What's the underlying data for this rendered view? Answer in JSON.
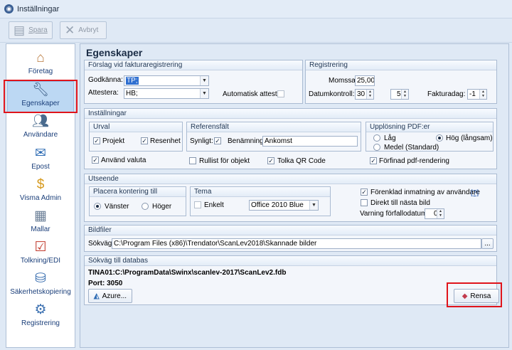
{
  "window": {
    "title": "Inställningar"
  },
  "toolbar": {
    "save_label": "Spara",
    "cancel_label": "Avbryt"
  },
  "sidebar": {
    "items": [
      {
        "label": "Företag",
        "icon": "house-icon"
      },
      {
        "label": "Egenskaper",
        "icon": "wrench-icon"
      },
      {
        "label": "Användare",
        "icon": "users-icon"
      },
      {
        "label": "Epost",
        "icon": "email-icon"
      },
      {
        "label": "Visma Admin",
        "icon": "coins-icon"
      },
      {
        "label": "Mallar",
        "icon": "grid-icon"
      },
      {
        "label": "Tolkning/EDI",
        "icon": "checklist-icon"
      },
      {
        "label": "Säkerhetskopiering",
        "icon": "database-icon"
      },
      {
        "label": "Registrering",
        "icon": "gears-icon"
      }
    ]
  },
  "main": {
    "title": "Egenskaper",
    "forslag": {
      "title": "Förslag vid fakturaregistrering",
      "godkanna_label": "Godkänna:",
      "godkanna_value": "TP;",
      "attestera_label": "Attestera:",
      "attestera_value": "HB;",
      "auto_attest_label": "Automatisk attest"
    },
    "registrering": {
      "title": "Registrering",
      "momssats_label": "Momssats:",
      "momssats_value": "25,00",
      "datumkontroll_label": "Datumkontroll:",
      "datum_val1": "30",
      "datum_val2": "5",
      "fakturadag_label": "Fakturadag:",
      "fakturadag_value": "-1"
    },
    "installningar": {
      "title": "Inställningar",
      "urval": {
        "title": "Urval",
        "projekt": "Projekt",
        "resenhet": "Resenhet"
      },
      "referensfalt": {
        "title": "Referensfält",
        "synligt": "Synligt:",
        "benamning_label": "Benämning:",
        "benamning_value": "Ankomst"
      },
      "upplosning": {
        "title": "Upplösning PDF:er",
        "lag": "Låg",
        "hog": "Hög (långsam)",
        "medel": "Medel (Standard)"
      },
      "anvand_valuta": "Använd valuta",
      "rullist": "Rullist för objekt",
      "tolka_qr": "Tolka QR Code",
      "forfinad_pdf": "Förfinad pdf-rendering"
    },
    "utseende": {
      "title": "Utseende",
      "placera": {
        "title": "Placera kontering till",
        "vanster": "Vänster",
        "hoger": "Höger"
      },
      "tema": {
        "title": "Tema",
        "enkelt": "Enkelt",
        "theme_value": "Office 2010 Blue"
      },
      "forenklad": "Förenklad inmatning av användare",
      "help": "[?]",
      "direkt": "Direkt till nästa bild",
      "varning_label": "Varning förfallodatum:",
      "varning_value": "0"
    },
    "bildfiler": {
      "title": "Bildfiler",
      "sokvag_label": "Sökväg:",
      "sokvag_value": "C:\\Program Files (x86)\\Trendator\\ScanLev2018\\Skannade bilder",
      "browse": "..."
    },
    "databas": {
      "title": "Sökväg till databas",
      "path": "TINA01:C:\\ProgramData\\Swinx\\scanlev-2017\\ScanLev2.fdb",
      "port": "Port: 3050",
      "azure_label": "Azure...",
      "rensa_label": "Rensa"
    }
  },
  "colors": {
    "accent": "#1b3f7a",
    "highlight": "#e0141b",
    "selected_bg": "#bcd8f3"
  }
}
